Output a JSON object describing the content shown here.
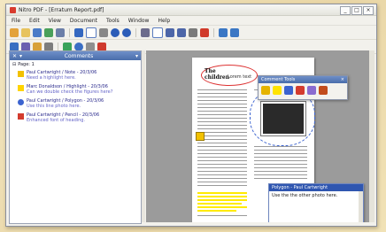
{
  "window": {
    "title": "Nitro PDF - [Erratum Report.pdf]"
  },
  "menu": [
    "File",
    "Edit",
    "View",
    "Document",
    "Tools",
    "Window",
    "Help"
  ],
  "comments_panel": {
    "title": "Comments",
    "tree_root": "Page: 1",
    "items": [
      {
        "icon": "note-icon",
        "color": "#f2c100",
        "line1": "Paul Cartwright / Note - 20/3/06",
        "line2": "Need a highlight here."
      },
      {
        "icon": "highlight-icon",
        "color": "#ffd400",
        "line1": "Marc Donaldson / Highlight - 20/3/06",
        "line2": "Can we double check the figures here?"
      },
      {
        "icon": "polygon-icon",
        "color": "#3b63d0",
        "line1": "Paul Cartwright / Polygon - 20/3/06",
        "line2": "Use this line photo here."
      },
      {
        "icon": "pencil-icon",
        "color": "#d33b2e",
        "line1": "Paul Cartwright / Pencil - 20/3/06",
        "line2": "Enhanced font of heading."
      }
    ]
  },
  "floating_toolbar": {
    "title": "Comment Tools"
  },
  "popup_note": {
    "header": "Polygon - Paul Cartwright",
    "text": "Use the the other photo here."
  },
  "document": {
    "heading_a": "The",
    "heading_b": "children",
    "heading_c": "Lorem text",
    "accent_colors": {
      "highlight": "#ffeb00",
      "cloud": "#3b63d0",
      "oval": "#dd3333"
    }
  }
}
